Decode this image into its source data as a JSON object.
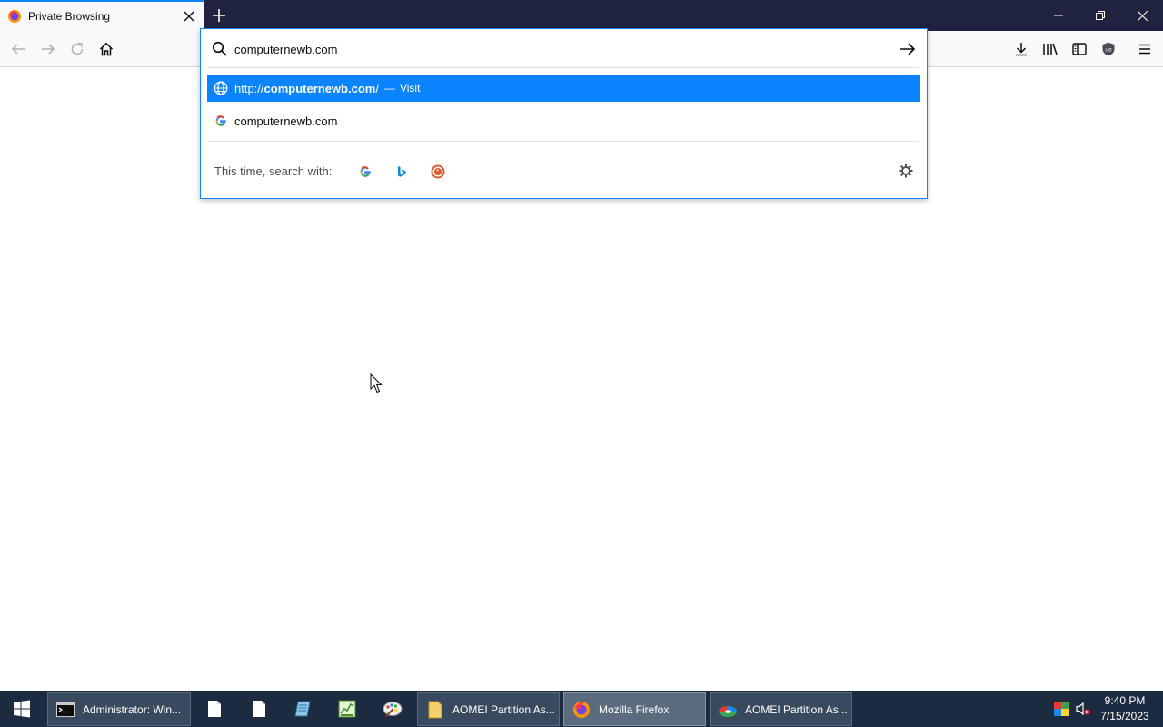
{
  "tab": {
    "title": "Private Browsing",
    "favicon": "firefox-icon"
  },
  "urlbar": {
    "value": "computernewb.com",
    "results": [
      {
        "prefix": "http://",
        "bold": "computernewb.com",
        "suffix": "/",
        "dash": "—",
        "action": "Visit",
        "icon": "globe-icon"
      },
      {
        "text": "computernewb.com",
        "icon": "google-icon"
      }
    ],
    "search_with_label": "This time, search with:",
    "engines": [
      "google-icon",
      "bing-icon",
      "duckduckgo-icon"
    ]
  },
  "taskbar": {
    "buttons": [
      {
        "label": "Administrator: Win...",
        "icon": "cmd-icon"
      },
      {
        "label": "AOMEI Partition As...",
        "icon": "folder-icon"
      },
      {
        "label": "Mozilla Firefox",
        "icon": "firefox-icon"
      },
      {
        "label": "AOMEI Partition As...",
        "icon": "aomei-icon"
      }
    ],
    "clock_time": "9:40 PM",
    "clock_date": "7/15/2023"
  },
  "colors": {
    "accent": "#0a84ff",
    "tabstrip": "#202340",
    "taskbar": "#1c2b3f"
  }
}
